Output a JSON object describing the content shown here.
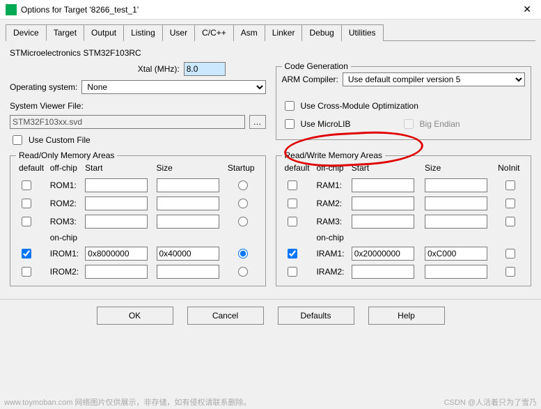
{
  "title": "Options for Target '8266_test_1'",
  "tabs": [
    "Device",
    "Target",
    "Output",
    "Listing",
    "User",
    "C/C++",
    "Asm",
    "Linker",
    "Debug",
    "Utilities"
  ],
  "active_tab": 1,
  "device_name": "STMicroelectronics STM32F103RC",
  "xtal_label": "Xtal (MHz):",
  "xtal_value": "8.0",
  "os_label": "Operating system:",
  "os_value": "None",
  "svf_label": "System Viewer File:",
  "svf_value": "STM32F103xx.svd",
  "use_custom_file": "Use Custom File",
  "code_gen": {
    "legend": "Code Generation",
    "arm_label": "ARM Compiler:",
    "arm_value": "Use default compiler version 5",
    "cross_opt": "Use Cross-Module Optimization",
    "microlib": "Use MicroLIB",
    "big_endian": "Big Endian"
  },
  "ro": {
    "legend": "Read/Only Memory Areas",
    "cols": [
      "default",
      "off-chip",
      "Start",
      "Size",
      "Startup"
    ],
    "onchip": "on-chip",
    "rows": [
      {
        "label": "ROM1:",
        "def": false,
        "start": "",
        "size": "",
        "startup": false
      },
      {
        "label": "ROM2:",
        "def": false,
        "start": "",
        "size": "",
        "startup": false
      },
      {
        "label": "ROM3:",
        "def": false,
        "start": "",
        "size": "",
        "startup": false
      },
      {
        "label": "IROM1:",
        "def": true,
        "start": "0x8000000",
        "size": "0x40000",
        "startup": true
      },
      {
        "label": "IROM2:",
        "def": false,
        "start": "",
        "size": "",
        "startup": false
      }
    ]
  },
  "rw": {
    "legend": "Read/Write Memory Areas",
    "cols": [
      "default",
      "off-chip",
      "Start",
      "Size",
      "NoInit"
    ],
    "onchip": "on-chip",
    "rows": [
      {
        "label": "RAM1:",
        "def": false,
        "start": "",
        "size": "",
        "noinit": false
      },
      {
        "label": "RAM2:",
        "def": false,
        "start": "",
        "size": "",
        "noinit": false
      },
      {
        "label": "RAM3:",
        "def": false,
        "start": "",
        "size": "",
        "noinit": false
      },
      {
        "label": "IRAM1:",
        "def": true,
        "start": "0x20000000",
        "size": "0xC000",
        "noinit": false
      },
      {
        "label": "IRAM2:",
        "def": false,
        "start": "",
        "size": "",
        "noinit": false
      }
    ]
  },
  "buttons": {
    "ok": "OK",
    "cancel": "Cancel",
    "defaults": "Defaults",
    "help": "Help"
  },
  "watermark": "www.toymoban.com  网络图片仅供展示，非存储，如有侵权请联系删除。",
  "csdn": "CSDN @人活着只为了雪乃"
}
